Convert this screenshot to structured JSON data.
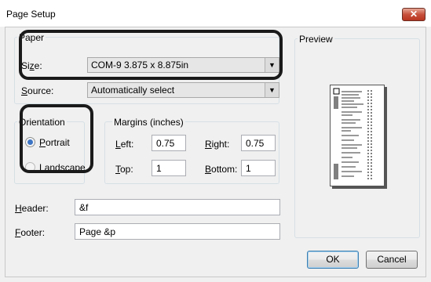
{
  "window": {
    "title": "Page Setup",
    "close_label": "✕"
  },
  "paper": {
    "group_label": "Paper",
    "size_label_prefix": "Si",
    "size_label_mnemonic": "z",
    "size_label_suffix": "e:",
    "size_value": "COM-9 3.875 x 8.875in",
    "source_label_mnemonic": "S",
    "source_label_suffix": "ource:",
    "source_value": "Automatically select"
  },
  "orientation": {
    "group_label": "Orientation",
    "portrait_mnemonic": "P",
    "portrait_suffix": "ortrait",
    "landscape_mnemonic": "L",
    "landscape_suffix": "andscape",
    "selected": "portrait"
  },
  "margins": {
    "group_label": "Margins (inches)",
    "left_mnemonic": "L",
    "left_suffix": "eft:",
    "left_value": "0.75",
    "right_mnemonic": "R",
    "right_suffix": "ight:",
    "right_value": "0.75",
    "top_mnemonic": "T",
    "top_suffix": "op:",
    "top_value": "1",
    "bottom_mnemonic": "B",
    "bottom_suffix": "ottom:",
    "bottom_value": "1"
  },
  "header": {
    "label_mnemonic": "H",
    "label_suffix": "eader:",
    "value": "&f"
  },
  "footer": {
    "label_mnemonic": "F",
    "label_suffix": "ooter:",
    "value": "Page &p"
  },
  "preview": {
    "group_label": "Preview"
  },
  "buttons": {
    "ok": "OK",
    "cancel": "Cancel"
  },
  "colors": {
    "radio_selected": "#3c74c4",
    "default_button_border": "#3c7fb1",
    "close_button": "#c7503b"
  }
}
